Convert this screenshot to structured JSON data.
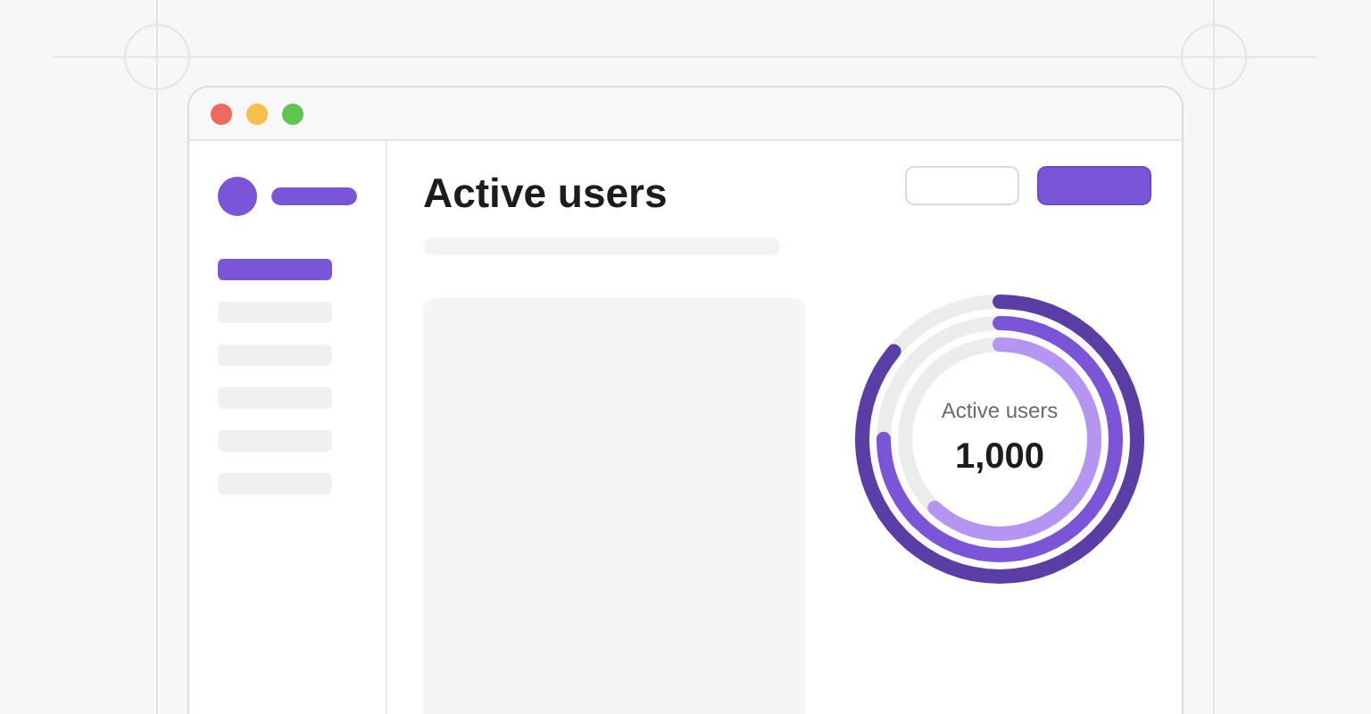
{
  "window": {
    "controls": [
      {
        "kind": "close"
      },
      {
        "kind": "minimize"
      },
      {
        "kind": "zoom"
      }
    ]
  },
  "sidebar": {
    "items": [
      {
        "selected": true
      },
      {
        "selected": false
      },
      {
        "selected": false
      },
      {
        "selected": false
      },
      {
        "selected": false
      },
      {
        "selected": false
      }
    ]
  },
  "header": {
    "title": "Active users",
    "buttons": [
      {
        "kind": "secondary"
      },
      {
        "kind": "primary"
      }
    ]
  },
  "chart": {
    "label": "Active users",
    "value": "1,000"
  }
}
